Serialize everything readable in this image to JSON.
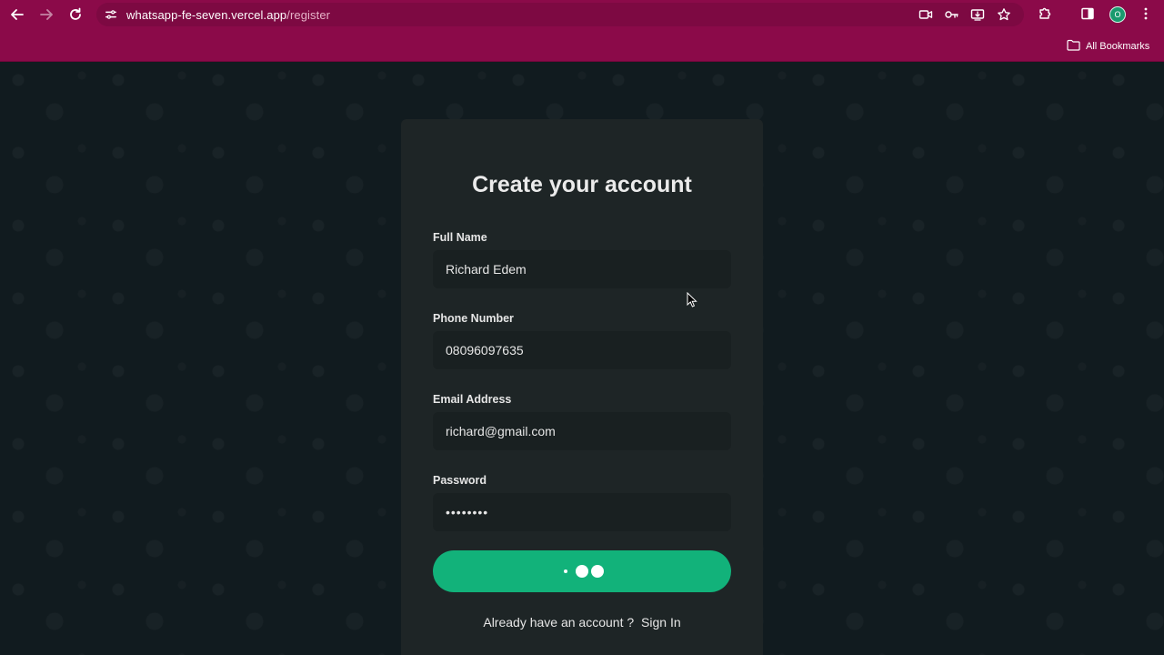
{
  "browser": {
    "url_host": "whatsapp-fe-seven.vercel.app",
    "url_path": "/register",
    "profile_initial": "O",
    "bookmarks_label": "All Bookmarks",
    "icons": [
      "back-icon",
      "forward-icon",
      "reload-icon",
      "site-info-icon",
      "camera-icon",
      "key-icon",
      "install-icon",
      "star-icon",
      "extensions-icon",
      "sidebar-icon",
      "more-icon",
      "folder-icon"
    ],
    "theme_color": "#8b0a49"
  },
  "form": {
    "title": "Create your account",
    "fields": [
      {
        "label": "Full Name",
        "value": "Richard Edem",
        "type": "text"
      },
      {
        "label": "Phone Number",
        "value": "08096097635",
        "type": "text"
      },
      {
        "label": "Email Address",
        "value": "richard@gmail.com",
        "type": "email"
      },
      {
        "label": "Password",
        "value": "••••••••",
        "type": "password"
      }
    ],
    "submit_state": "loading",
    "footer_text": "Already have an account ?",
    "sign_in_label": "Sign In",
    "accent_color": "#12b27a"
  }
}
